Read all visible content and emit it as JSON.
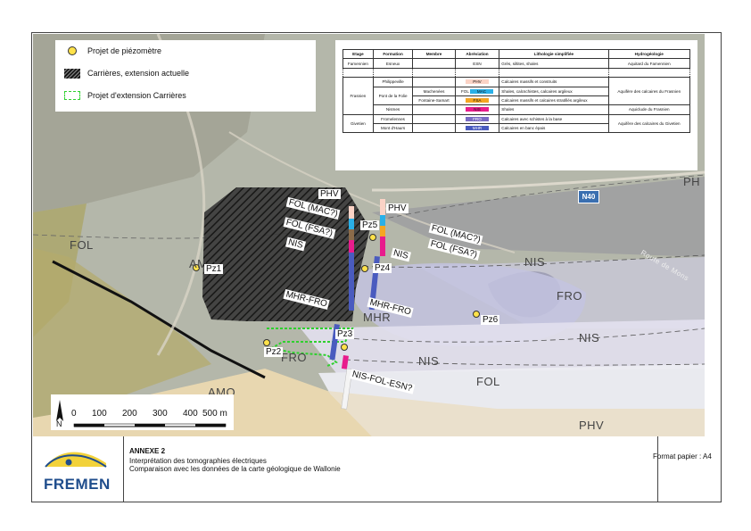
{
  "legend": {
    "items": [
      {
        "label": "Projet de piézomètre",
        "icon": "piezometer-dot-icon"
      },
      {
        "label": "Carrières, extension actuelle",
        "icon": "quarry-hatch-icon"
      },
      {
        "label": "Projet d'extension Carrières",
        "icon": "extension-dashed-icon"
      }
    ]
  },
  "strat_table": {
    "headers": [
      "Etage",
      "Formation",
      "Membre",
      "Abréviation",
      "Lithologie simplifiée",
      "Hydrogéologie"
    ],
    "famennien": {
      "etage": "Famennien",
      "formation": "Esneux",
      "abbr": "ESN",
      "litho": "Grès, siltites, shales",
      "hydro": "Aquitard du Famennien"
    },
    "frasnien_etage": "Frasnien",
    "givetien_etage": "Givetien",
    "rows": [
      {
        "formation": "Philippeville",
        "membre": "",
        "abbr": "PHV",
        "litho": "Calcaires massifs et construits",
        "color": "#fbd3c6"
      },
      {
        "formation": "Pont de la Folie",
        "membre": "Machenées",
        "abbr": "MAC",
        "litho": "Shales, calcschistes, calcaires argileux",
        "color": "#2ab0e8"
      },
      {
        "formation": "",
        "membre": "Fontaine-Samart",
        "abbr": "FSA",
        "litho": "Calcaires massifs et calcaires stratifiés argileux",
        "color": "#f5a623"
      },
      {
        "formation": "Nismes",
        "membre": "",
        "abbr": "NIS",
        "litho": "Shales",
        "color": "#e81c8c"
      },
      {
        "formation": "Fromelennes",
        "membre": "",
        "abbr": "FRO",
        "litho": "Calcaires avec schistes à la base",
        "color": "#7b6cc4"
      },
      {
        "formation": "Mont d'Haurs",
        "membre": "",
        "abbr": "MHR",
        "litho": "Calcaires en banc épais",
        "color": "#4a5bbf"
      }
    ],
    "fol_abbr": "FOL",
    "hydro_frasnien": "Aquifère des calcaires du Frasnien",
    "hydro_nismes": "Aquiclude du Frasnien",
    "hydro_givetien": "Aquifère des calcaires du Givetien"
  },
  "map_labels": {
    "fol_left": "FOL",
    "amo_top": "AMO",
    "amo_bottom": "AMO",
    "nis_mid": "NIS",
    "fro_mid": "FRO",
    "nis_right": "NIS",
    "mhr": "MHR",
    "fro_bottom": "FRO",
    "nis_bottom": "NIS",
    "fol_bottom": "FOL",
    "phv_bottom": "PHV",
    "ph_corner": "PH",
    "road": "Route de Mons",
    "n40": "N40"
  },
  "profile_labels": {
    "phv_left": "PHV",
    "phv_right": "PHV",
    "fol_mac_left": "FOL (MAC?)",
    "fol_fsa_left": "FOL (FSA?)",
    "nis_left": "NIS",
    "mhr_fro_left": "MHR-FRO",
    "fol_mac_right": "FOL (MAC?)",
    "fol_fsa_right": "FOL (FSA?)",
    "nis_right": "NIS",
    "mhr_fro_right": "MHR-FRO",
    "nis_fol_esn": "NIS-FOL-ESN?"
  },
  "piezometers": [
    "Pz1",
    "Pz2",
    "Pz3",
    "Pz4",
    "Pz5",
    "Pz6"
  ],
  "scale": {
    "north": "N",
    "ticks": [
      "0",
      "100",
      "200",
      "300",
      "400",
      "500 m"
    ]
  },
  "title_block": {
    "logo_text": "FREMEN",
    "annex": "ANNEXE 2",
    "line1": "Interprétation des tomographies électriques",
    "line2": "Comparaison avec les données de la carte géologique de Wallonie",
    "format": "Format papier : A4"
  },
  "colors": {
    "piezometer": "#ffe24a",
    "extension": "#2ed02e",
    "brand_yellow": "#f2d23a",
    "brand_blue": "#1f4d8c"
  }
}
